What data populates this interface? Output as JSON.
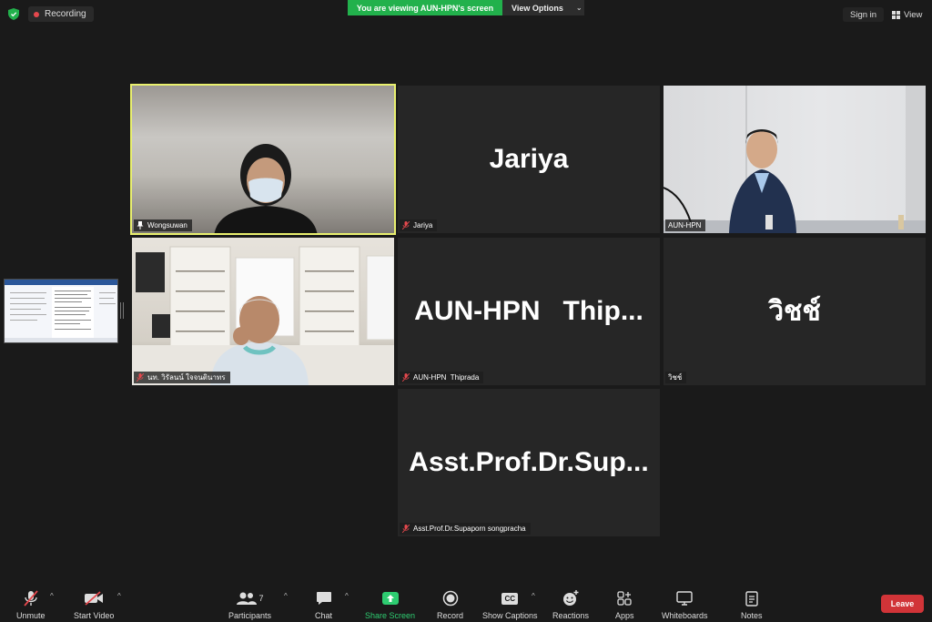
{
  "topbar": {
    "recording_label": "Recording",
    "viewing_banner": "You are viewing AUN-HPN's screen",
    "view_options_label": "View Options",
    "sign_in_label": "Sign in",
    "view_label": "View"
  },
  "tiles": [
    {
      "name": "Wongsuwan",
      "type": "video",
      "active_speaker": true,
      "pinned": true
    },
    {
      "name": "Jariya",
      "display": "Jariya",
      "type": "name",
      "muted": true
    },
    {
      "name": "AUN-HPN",
      "type": "video"
    },
    {
      "name": "นท. วิรัลนน์ ใจจนตินาทร",
      "type": "video",
      "muted": true
    },
    {
      "name": "AUN-HPN  Thiprada",
      "display": "AUN-HPN   Thip...",
      "type": "name",
      "muted": true
    },
    {
      "name": "วิชช์",
      "display": "วิชช์",
      "type": "name"
    },
    {
      "name": "Asst.Prof.Dr.Supaporn songpracha",
      "display": "Asst.Prof.Dr.Sup...",
      "type": "name",
      "muted": true
    }
  ],
  "toolbar": {
    "unmute": "Unmute",
    "start_video": "Start Video",
    "participants": "Participants",
    "participants_count": "7",
    "chat": "Chat",
    "share_screen": "Share Screen",
    "record": "Record",
    "show_captions": "Show Captions",
    "captions_icon_text": "CC",
    "reactions": "Reactions",
    "apps": "Apps",
    "whiteboards": "Whiteboards",
    "notes": "Notes",
    "leave": "Leave"
  },
  "colors": {
    "active_border": "#e9f06e",
    "viewing_banner": "#22b14c",
    "leave": "#d13438",
    "share_screen": "#2ecc71",
    "recording_dot": "#e5484d"
  }
}
